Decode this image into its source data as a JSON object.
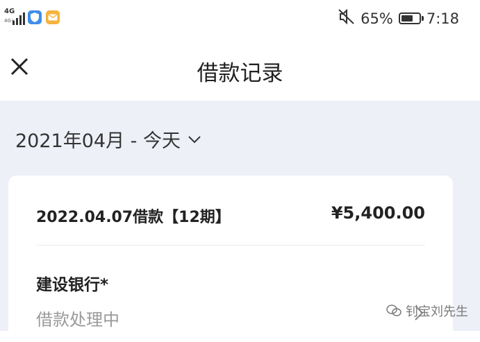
{
  "status_bar": {
    "network_type": "4G",
    "network_sub": "4G+",
    "battery_percent": "65%",
    "time": "7:18",
    "icons": [
      "signal-icon",
      "shield-app-icon",
      "mail-app-icon",
      "mute-icon",
      "battery-icon"
    ]
  },
  "header": {
    "title": "借款记录",
    "close_icon": "close-icon"
  },
  "filter": {
    "date_range": "2021年04月 - 今天",
    "icon": "chevron-down-icon"
  },
  "records": [
    {
      "title": "2022.04.07借款【12期】",
      "amount": "¥5,400.00",
      "bank": "建设银行*",
      "status": "借款处理中"
    }
  ],
  "watermark": {
    "text": "钊宝刘先生"
  },
  "colors": {
    "background": "#eef0f8",
    "card": "#ffffff",
    "muted_text": "#9a9a9a"
  }
}
